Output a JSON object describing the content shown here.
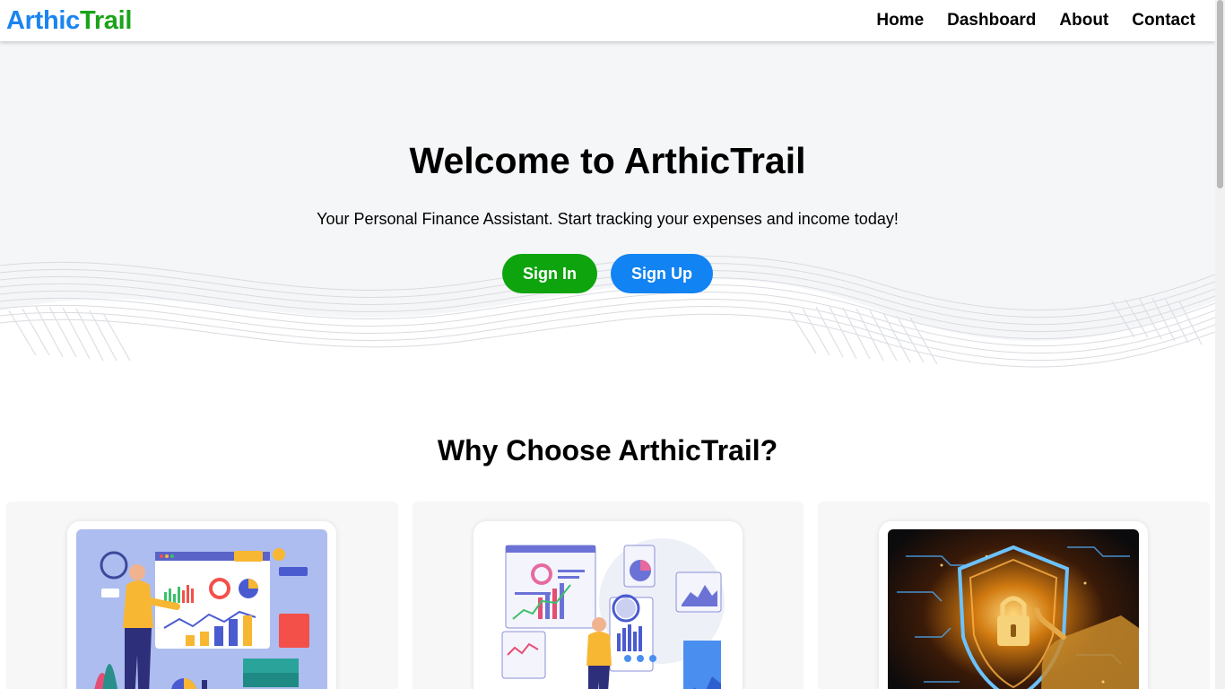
{
  "brand": {
    "part1": "Arthic",
    "part2": "Trail",
    "color1": "#1a84f0",
    "color2": "#1aa31a"
  },
  "nav": {
    "items": [
      "Home",
      "Dashboard",
      "About",
      "Contact"
    ]
  },
  "hero": {
    "title": "Welcome to ArthicTrail",
    "subtitle": "Your Personal Finance Assistant. Start tracking your expenses and income today!",
    "signin_label": "Sign In",
    "signup_label": "Sign Up",
    "signin_color": "#0ea40e",
    "signup_color": "#1283f2"
  },
  "features": {
    "title": "Why Choose ArthicTrail?",
    "cards": [
      {
        "image": "analytics-presentation-illustration"
      },
      {
        "image": "data-analysis-illustration"
      },
      {
        "image": "security-lock-illustration"
      }
    ]
  }
}
